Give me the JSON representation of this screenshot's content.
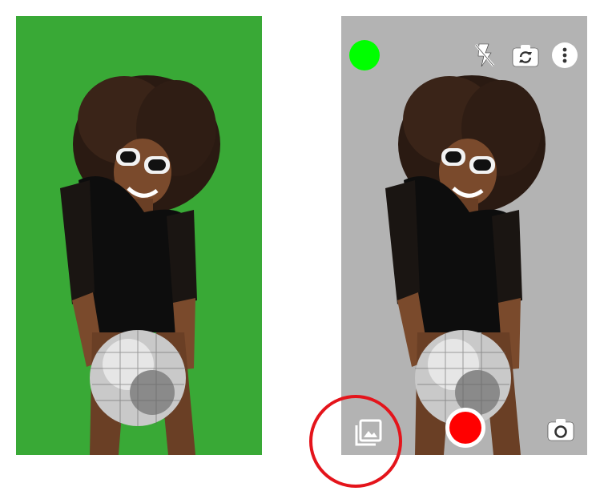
{
  "left_preview": {
    "background_color": "#39a936",
    "subject": "woman-with-disco-ball"
  },
  "camera_view": {
    "background_color": "#b3b3b3",
    "chroma_key_color": "#00ff00",
    "record_button_color": "#ff0000",
    "top_bar": {
      "icons": [
        "color-picker-dot",
        "flash-off-icon",
        "switch-camera-icon",
        "more-options-icon"
      ]
    },
    "bottom_bar": {
      "icons": [
        "gallery-icon",
        "record-button",
        "capture-photo-icon"
      ]
    }
  },
  "annotation": {
    "highlight_color": "#e4141b",
    "target": "gallery-icon"
  }
}
